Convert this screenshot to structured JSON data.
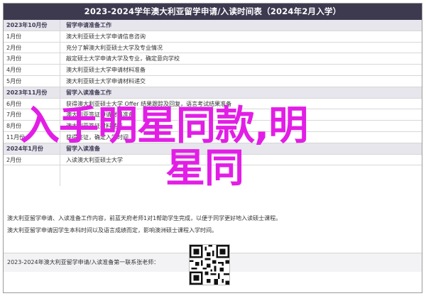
{
  "title": "2023-2024学年澳大利亚留学申请/入读时间表（2024年2月入学）",
  "rows": [
    {
      "section": true,
      "time": "2023年10月份",
      "event": "留学申请准备工作"
    },
    {
      "section": false,
      "time": "1月份",
      "event": "澳大利亚硕士大学申请信息咨询"
    },
    {
      "section": false,
      "time": "2月份",
      "event": "充分了解澳大利亚硕士大学及专业情况"
    },
    {
      "section": false,
      "time": "3月份",
      "event": "敲定硕士大学申请大学及专业，确定意向学校"
    },
    {
      "section": false,
      "time": "4月份",
      "event": "澳大利亚硕士大学申请材料准备"
    },
    {
      "section": false,
      "time": "5月份",
      "event": "澳大利亚硕士大学申请材料递交"
    },
    {
      "section": true,
      "time": "2023年11月份",
      "event": "留学入读准备工作"
    },
    {
      "section": false,
      "time": "6月份",
      "event": "获得澳大利亚硕士大学 Offer 结果跟踪及回复，语言考试结果准备"
    },
    {
      "section": false,
      "time": "7月份",
      "event": "澳大利亚签证申请材料准备"
    },
    {
      "section": false,
      "time": "8月份",
      "event": "澳大利亚签证材料递交"
    },
    {
      "section": false,
      "time": "11月份",
      "event": "获得签证，确定入学时间"
    },
    {
      "section": true,
      "time": "2024年1月份",
      "event": "留学入读准备"
    },
    {
      "section": false,
      "time": "2月份",
      "event": "入读澳大利亚硕士大学"
    }
  ],
  "overlay": {
    "line1": "入手明星同款,明",
    "line2": "星同"
  },
  "notes": {
    "n1": "澳大利亚留学申请、入读准备工作内容，前蓝天府老师1对1帮助学生完成，以便于同学更好地入读硕士课程。",
    "n2": "澳大利亚留学申请因学生本科时间以及语言成绩而定，影响澳洲硕士课程入学时间。"
  },
  "footer": "2023-2024年澳大利亚留学申请/入读准备第一联系张老师："
}
